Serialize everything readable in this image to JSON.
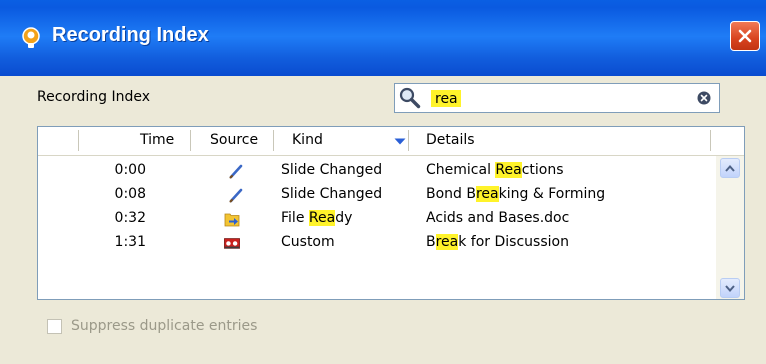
{
  "window": {
    "title": "Recording Index",
    "close_label": "Close"
  },
  "panel": {
    "label": "Recording Index"
  },
  "search": {
    "value": "rea",
    "placeholder": ""
  },
  "table": {
    "columns": [
      "Time",
      "Source",
      "Kind",
      "Details"
    ],
    "sorted_column": "Kind",
    "sort_direction": "descending",
    "rows": [
      {
        "time": "0:00",
        "source_icon": "pen-icon",
        "kind": {
          "pre": "Slide Changed",
          "hl": "",
          "post": ""
        },
        "details": {
          "pre": "Chemical ",
          "hl": "Rea",
          "post": "ctions"
        }
      },
      {
        "time": "0:08",
        "source_icon": "pen-icon",
        "kind": {
          "pre": "Slide Changed",
          "hl": "",
          "post": ""
        },
        "details": {
          "pre": "Bond B",
          "hl": "rea",
          "post": "king & Forming"
        }
      },
      {
        "time": "0:32",
        "source_icon": "file-arrow-icon",
        "kind": {
          "pre": "File ",
          "hl": "Rea",
          "post": "dy"
        },
        "details": {
          "pre": "Acids and Bases.doc",
          "hl": "",
          "post": ""
        }
      },
      {
        "time": "1:31",
        "source_icon": "custom-tag-icon",
        "kind": {
          "pre": "Custom",
          "hl": "",
          "post": ""
        },
        "details": {
          "pre": "B",
          "hl": "rea",
          "post": "k for Discussion"
        }
      }
    ]
  },
  "options": {
    "suppress_label": "Suppress duplicate entries",
    "suppress_checked": false,
    "suppress_enabled": false
  },
  "colors": {
    "title_bar": "#0a5fe3",
    "highlight": "#fff32a",
    "dialog_bg": "#ece9d8",
    "close_button": "#d8431f"
  }
}
